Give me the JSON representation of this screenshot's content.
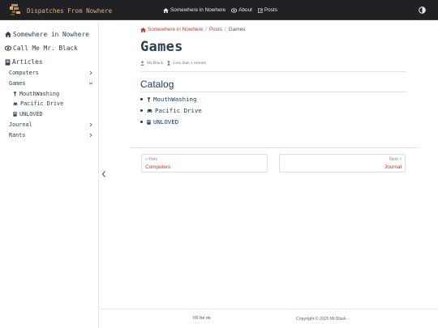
{
  "navbar": {
    "brand_title": "Dispatches From Nowhere",
    "links": [
      {
        "label": "Somewhere in Nowhere",
        "icon": "home-icon"
      },
      {
        "label": "About",
        "icon": "eye-icon"
      },
      {
        "label": "Posts",
        "icon": "edit-icon"
      }
    ],
    "theme_icon": "contrast-icon"
  },
  "sidebar": {
    "top_items": [
      {
        "label": "Somewhere in Nowhere",
        "icon": "home-icon"
      },
      {
        "label": "Call Me Mr. Black",
        "icon": "eye-icon"
      },
      {
        "label": "Articles",
        "icon": "book-icon"
      }
    ],
    "sections": [
      {
        "label": "Computers",
        "expanded": false
      },
      {
        "label": "Games",
        "expanded": true
      },
      {
        "label": "Journal",
        "expanded": false
      },
      {
        "label": "Rants",
        "expanded": false
      }
    ],
    "games_children": [
      {
        "label": "MouthWashing",
        "icon": "glass-icon"
      },
      {
        "label": "Pacific Drive",
        "icon": "car-icon"
      },
      {
        "label": "UNLOVED",
        "icon": "book-icon"
      }
    ]
  },
  "breadcrumb": {
    "home": "Somewhere in Nowhere",
    "sep1": "/",
    "posts": "Posts",
    "sep2": "/",
    "current": "Games"
  },
  "page": {
    "title": "Games",
    "author": "Mr.Black",
    "reading_time": "Less than 1 minute",
    "catalog_heading": "Catalog",
    "catalog": [
      {
        "label": "MouthWashing",
        "icon": "glass-icon"
      },
      {
        "label": "Pacific Drive",
        "icon": "car-icon"
      },
      {
        "label": "UNLOVED",
        "icon": "book-icon"
      }
    ]
  },
  "pager": {
    "prev_small": "« Prev",
    "prev_label": "Computers",
    "next_small": "Next »",
    "next_label": "Journal"
  },
  "footer": {
    "left": "It'll be ok",
    "right": "Copyright © 2025 Mr.Black"
  },
  "colors": {
    "navbar_bg": "#202124",
    "accent_link": "#c0392b",
    "heading": "#1a3a5c"
  }
}
